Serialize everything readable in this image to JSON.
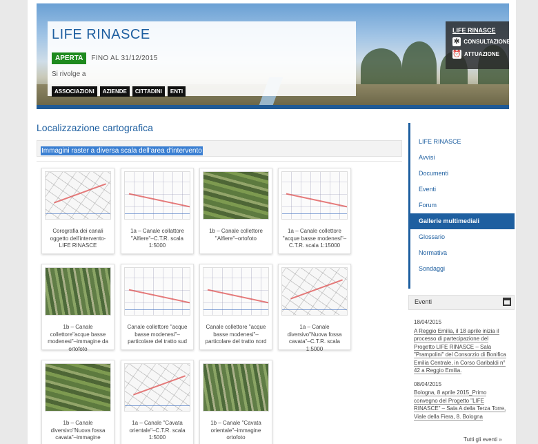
{
  "banner": {
    "title": "LIFE RINASCE",
    "status": "APERTA",
    "until": "FINO AL 31/12/2015",
    "addressed_to": "Si rivolge a",
    "tags": [
      "ASSOCIAZIONI",
      "AZIENDE",
      "CITTADINI",
      "ENTI"
    ],
    "menu": {
      "title": "LIFE RINASCE",
      "items": [
        {
          "label": "CONSULTAZIONE",
          "icon": "gear-icon"
        },
        {
          "label": "ATTUAZIONE",
          "icon": "alarm-clock-icon"
        }
      ]
    }
  },
  "main": {
    "title": "Localizzazione cartografica",
    "subtitle": "Immagini raster a diversa scala dell'area d'intervento",
    "gallery": [
      {
        "caption": "Corografia dei canali oggetto dell'intervento-LIFE RINASCE",
        "kind": "map"
      },
      {
        "caption": "1a – Canale collattore \"Alfiere\"–C.T.R. scala 1:5000",
        "kind": "map2"
      },
      {
        "caption": "1b – Canale collettore \"Alfiere\"–ortofoto",
        "kind": "photo"
      },
      {
        "caption": "1a – Canale collettore \"acque basse modenesi\"–C.T.R. scala 1:15000",
        "kind": "map2"
      },
      {
        "caption": "1b – Canale collettore\"acque basse modenesi\"–immagine da ortofoto",
        "kind": "photo2"
      },
      {
        "caption": "Canale collettore \"acque basse modenesi\"–particolare del tratto sud",
        "kind": "map2"
      },
      {
        "caption": "Canale collettore \"acque basse modenesi\"–particolare del tratto nord",
        "kind": "map2"
      },
      {
        "caption": "1a – Canale diversivo\"Nuova fossa cavata\"–C.T.R. scala 1:5000",
        "kind": "map"
      },
      {
        "caption": "1b – Canale diversivo\"Nuova fossa cavata\"–immagine",
        "kind": "photo"
      },
      {
        "caption": "1a – Canale \"Cavata orientale\"–C.T.R. scala 1:5000",
        "kind": "map"
      },
      {
        "caption": "1b – Canale \"Cavata orientale\"–immagine ortofoto",
        "kind": "photo2"
      }
    ]
  },
  "sidebar": {
    "nav": [
      {
        "label": "LIFE RINASCE",
        "active": false
      },
      {
        "label": "Avvisi",
        "active": false
      },
      {
        "label": "Documenti",
        "active": false
      },
      {
        "label": "Eventi",
        "active": false
      },
      {
        "label": "Forum",
        "active": false
      },
      {
        "label": "Gallerie multimediali",
        "active": true
      },
      {
        "label": "Glossario",
        "active": false
      },
      {
        "label": "Normativa",
        "active": false
      },
      {
        "label": "Sondaggi",
        "active": false
      }
    ],
    "events_title": "Eventi",
    "events": [
      {
        "date": "18/04/2015",
        "text": "A Reggio Emilia, il 18 aprile inizia il processo di partecipazione del Progetto LIFE RINASCE – Sala \"Prampolini\" del Consorzio di Bonifica Emilia Centrale, in Corso Garibaldi n° 42 a Reggio Emilia."
      },
      {
        "date": "08/04/2015",
        "text": "Bologna, 8 aprile 2015_Primo convegno del Progetto \"LIFE RINASCE\" – Sala A della Terza Torre, Viale della Fiera, 8. Bologna"
      }
    ],
    "all_events": "Tutti gli eventi »"
  }
}
